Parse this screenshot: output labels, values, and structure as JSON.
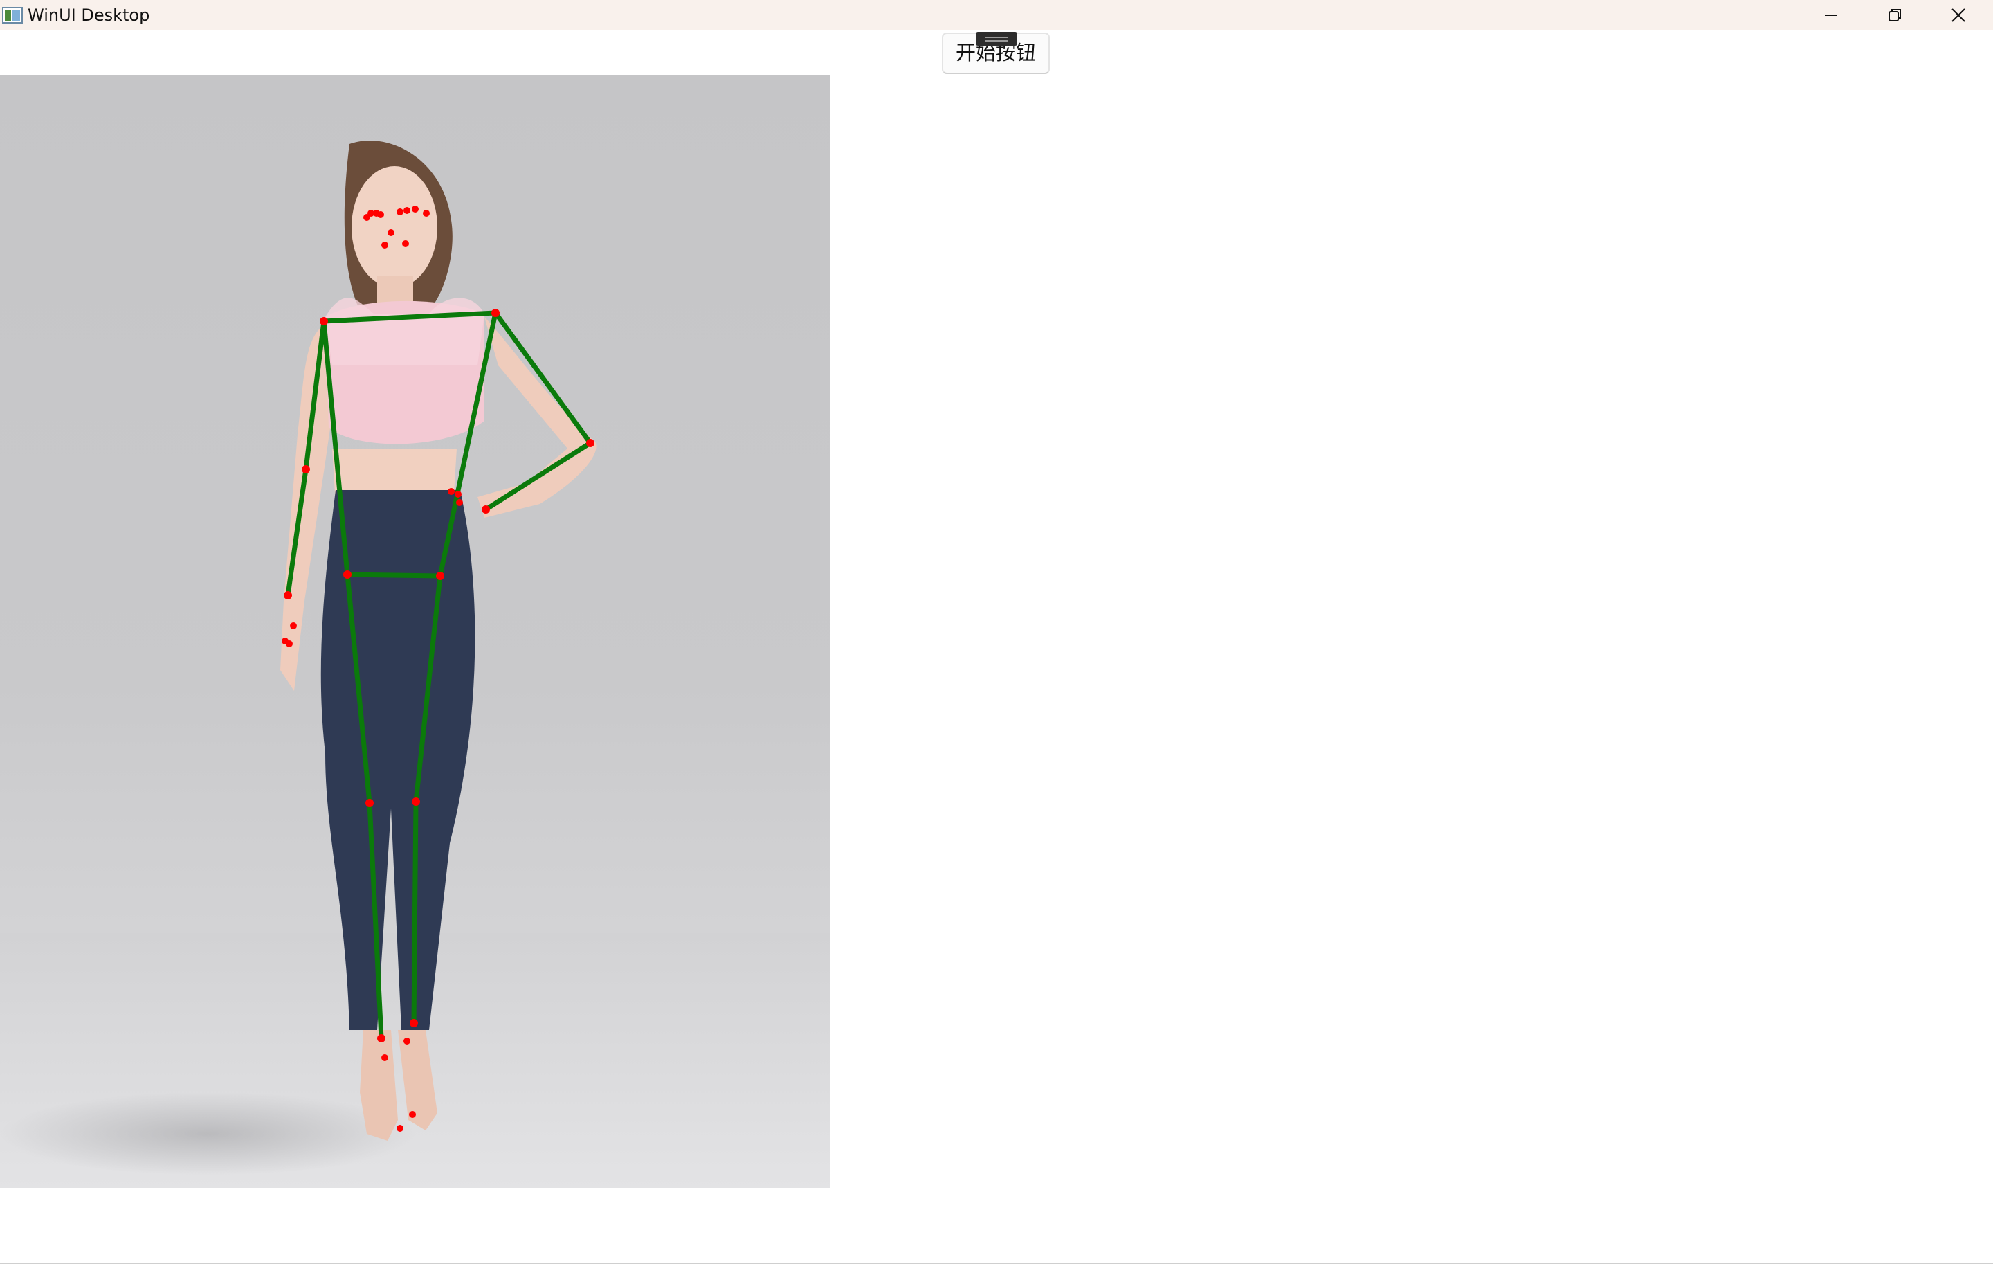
{
  "window": {
    "title": "WinUI Desktop",
    "controls": [
      "minimize-icon",
      "restore-icon",
      "close-icon"
    ]
  },
  "toolbar": {
    "start_button_label": "开始按钮"
  },
  "pose": {
    "skeleton_color": "#0b7a0b",
    "keypoint_color": "#ff0000",
    "keypoints_count": 33
  }
}
